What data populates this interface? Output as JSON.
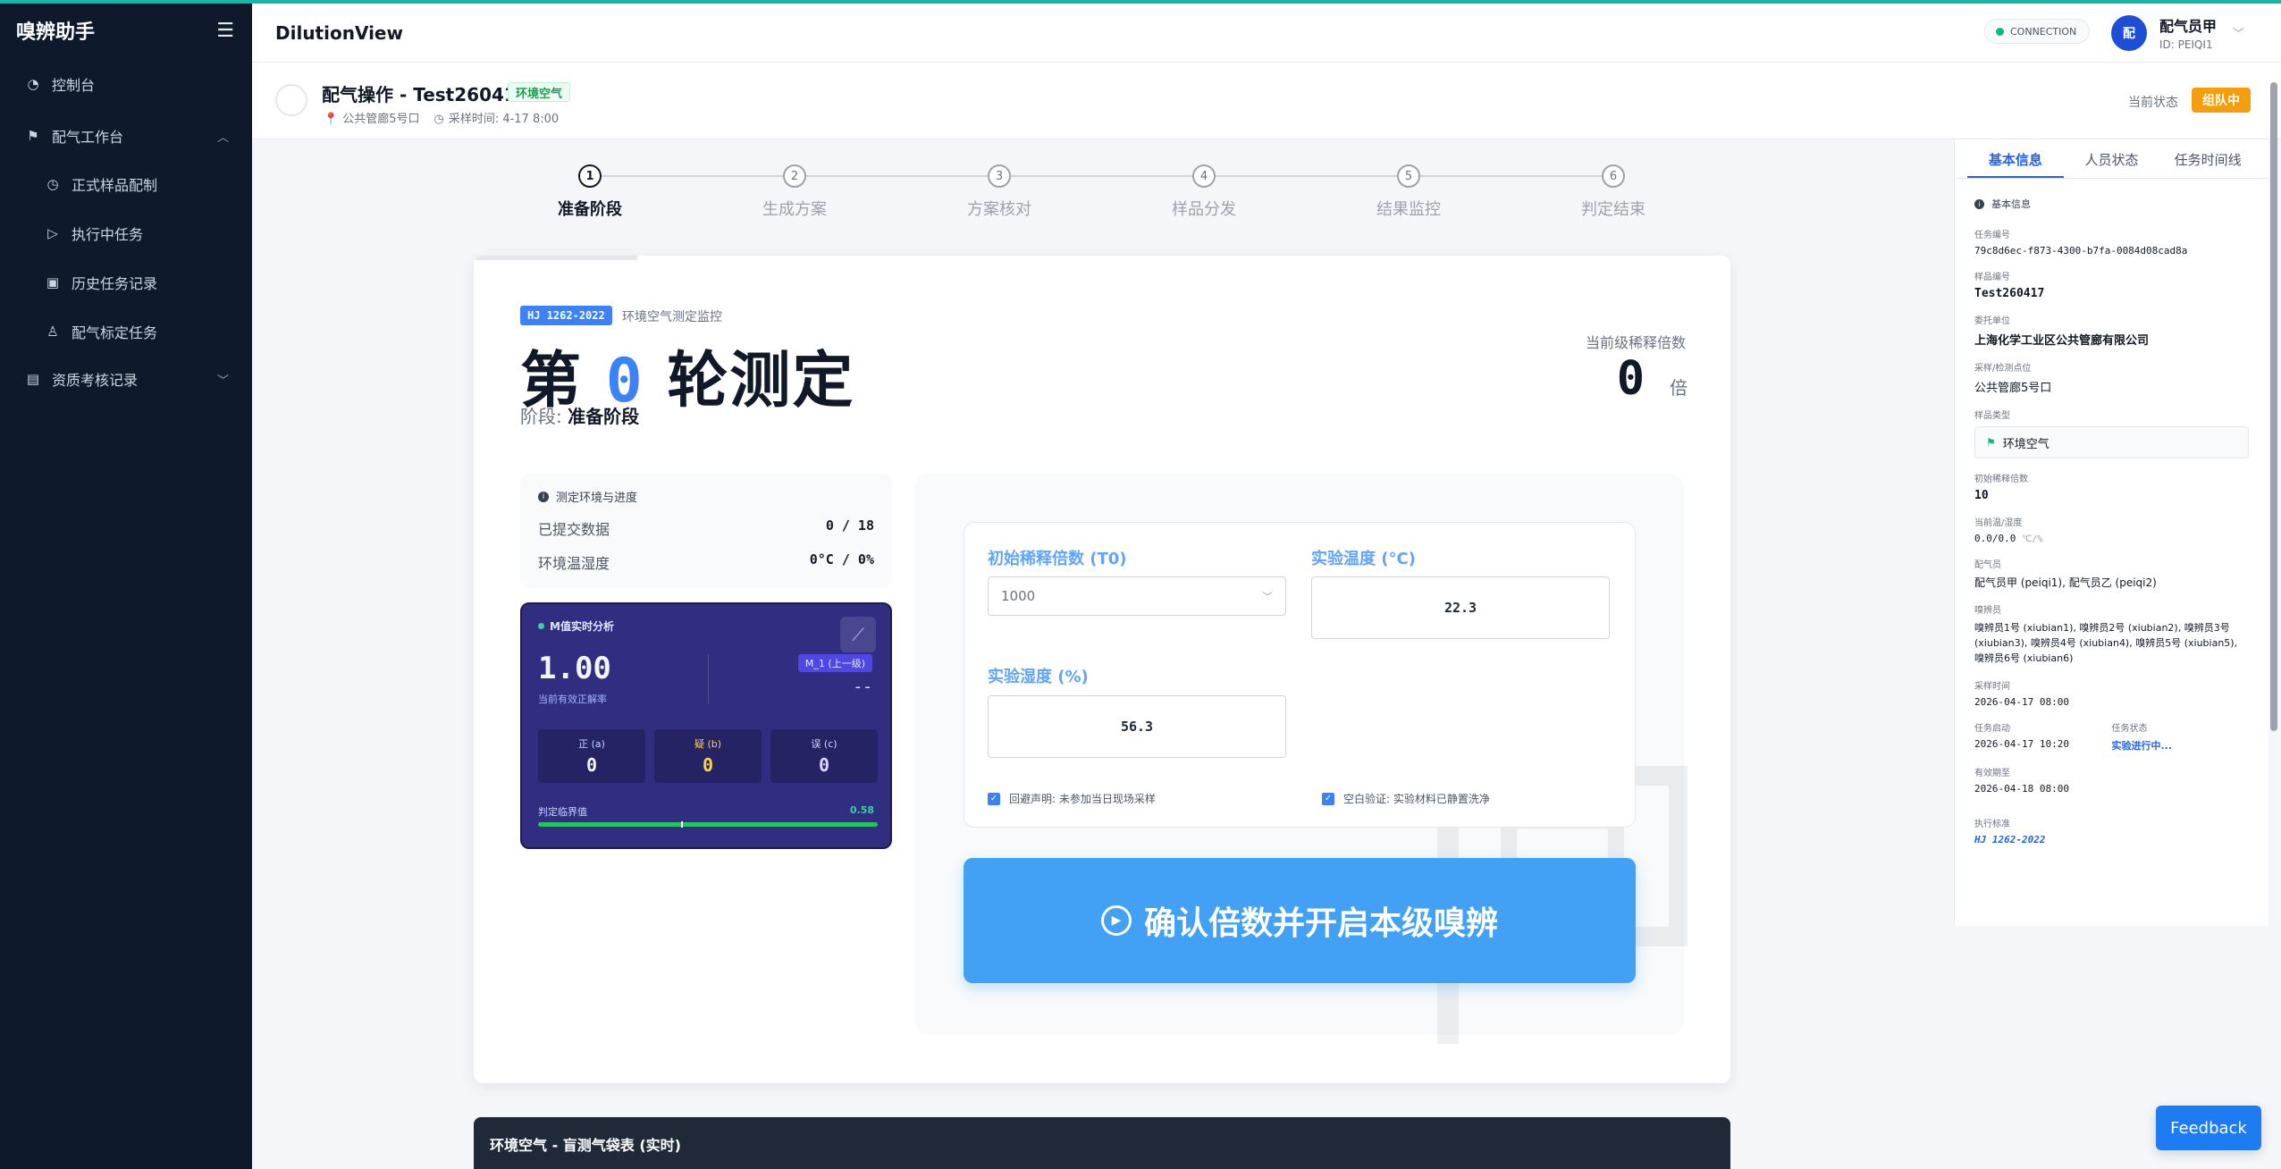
{
  "app": {
    "brand": "嗅辨助手",
    "window_title": "DilutionView"
  },
  "sidebar": {
    "items": [
      {
        "label": "控制台",
        "icon": "dashboard-icon"
      },
      {
        "label": "配气工作台",
        "icon": "flag-icon",
        "expanded": true
      },
      {
        "label": "正式样品配制",
        "icon": "clock-icon"
      },
      {
        "label": "执行中任务",
        "icon": "play-circle-icon"
      },
      {
        "label": "历史任务记录",
        "icon": "save-icon"
      },
      {
        "label": "配气标定任务",
        "icon": "user-icon"
      },
      {
        "label": "资质考核记录",
        "icon": "clipboard-check-icon",
        "expanded": false
      }
    ]
  },
  "header": {
    "connection": "CONNECTION",
    "user": {
      "avatar": "配",
      "name": "配气员甲",
      "id": "ID: PEIQI1"
    }
  },
  "task": {
    "title": "配气操作 - Test260417",
    "tag": "环境空气",
    "location": "公共管廊5号口",
    "sample_time": "采样时间: 4-17 8:00",
    "status_label": "当前状态",
    "status": "组队中"
  },
  "stepper": {
    "steps": [
      {
        "num": "1",
        "label": "准备阶段",
        "active": true
      },
      {
        "num": "2",
        "label": "生成方案"
      },
      {
        "num": "3",
        "label": "方案核对"
      },
      {
        "num": "4",
        "label": "样品分发"
      },
      {
        "num": "5",
        "label": "结果监控"
      },
      {
        "num": "6",
        "label": "判定结束"
      }
    ]
  },
  "round": {
    "standard": "HJ 1262-2022",
    "standard_desc": "环境空气测定监控",
    "title_prefix": "第",
    "number": "0",
    "title_suffix": "轮测定",
    "phase_label": "阶段:",
    "phase": "准备阶段",
    "dilution_label": "当前级稀释倍数",
    "dilution_value": "0",
    "dilution_unit": "倍",
    "progress_fraction": 0.13
  },
  "env": {
    "title": "测定环境与进度",
    "submitted_label": "已提交数据",
    "submitted_value": "0 / 18",
    "temp_hum_label": "环境温湿度",
    "temp_hum_value": "0°C / 0%"
  },
  "m_analysis": {
    "title": "M值实时分析",
    "value": "1.00",
    "subtitle": "当前有效正解率",
    "prev_tag": "M_1 (上一级)",
    "prev_value": "--",
    "cells": [
      {
        "label": "正 (a)",
        "value": "0"
      },
      {
        "label": "疑 (b)",
        "value": "0"
      },
      {
        "label": "误 (c)",
        "value": "0"
      }
    ],
    "threshold_label": "判定临界值",
    "threshold_value": "0.58",
    "threshold_fraction": 0.42,
    "current_fraction": 1.0
  },
  "form": {
    "init_dilution_label": "初始稀释倍数 (T0)",
    "init_dilution_value": "1000",
    "temp_label": "实验温度 (°C)",
    "temp_value": "22.3",
    "humidity_label": "实验湿度 (%)",
    "humidity_value": "56.3",
    "check1": "回避声明: 未参加当日现场采样",
    "check2": "空白验证: 实验材料已静置洗净",
    "confirm_button": "确认倍数并开启本级嗅辨"
  },
  "bottom_bar": {
    "title": "环境空气 - 盲测气袋表 (实时)"
  },
  "right_panel": {
    "tabs": [
      "基本信息",
      "人员状态",
      "任务时间线"
    ],
    "section_title": "基本信息",
    "fields": {
      "task_no_label": "任务编号",
      "task_no": "79c8d6ec-f873-4300-b7fa-0084d08cad8a",
      "sample_no_label": "样品编号",
      "sample_no": "Test260417",
      "client_label": "委托单位",
      "client": "上海化学工业区公共管廊有限公司",
      "site_label": "采样/检测点位",
      "site": "公共管廊5号口",
      "type_label": "样品类型",
      "type": "环境空气",
      "init_dil_label": "初始稀释倍数",
      "init_dil": "10",
      "temp_hum_label": "当前温/湿度",
      "temp_hum": "0.0/0.0",
      "temp_hum_unit": "℃/%",
      "preparer_label": "配气员",
      "preparer": "配气员甲 (peiqi1), 配气员乙 (peiqi2)",
      "panelist_label": "嗅辨员",
      "panelist": "嗅辨员1号 (xiubian1), 嗅辨员2号 (xiubian2), 嗅辨员3号 (xiubian3), 嗅辨员4号 (xiubian4), 嗅辨员5号 (xiubian5), 嗅辨员6号 (xiubian6)",
      "sample_time_label": "采样时间",
      "sample_time": "2026-04-17 08:00",
      "start_label": "任务启动",
      "start": "2026-04-17 10:20",
      "state_label": "任务状态",
      "state": "实验进行中...",
      "valid_label": "有效期至",
      "valid": "2026-04-18 08:00",
      "std_label": "执行标准",
      "std": "HJ 1262-2022"
    }
  },
  "feedback": "Feedback",
  "colors": {
    "sidebar": "#0e1a2b",
    "accent": "#3b82f6",
    "confirm": "#42a0f5",
    "warning": "#f59e0b",
    "m_panel": "#312e81"
  }
}
